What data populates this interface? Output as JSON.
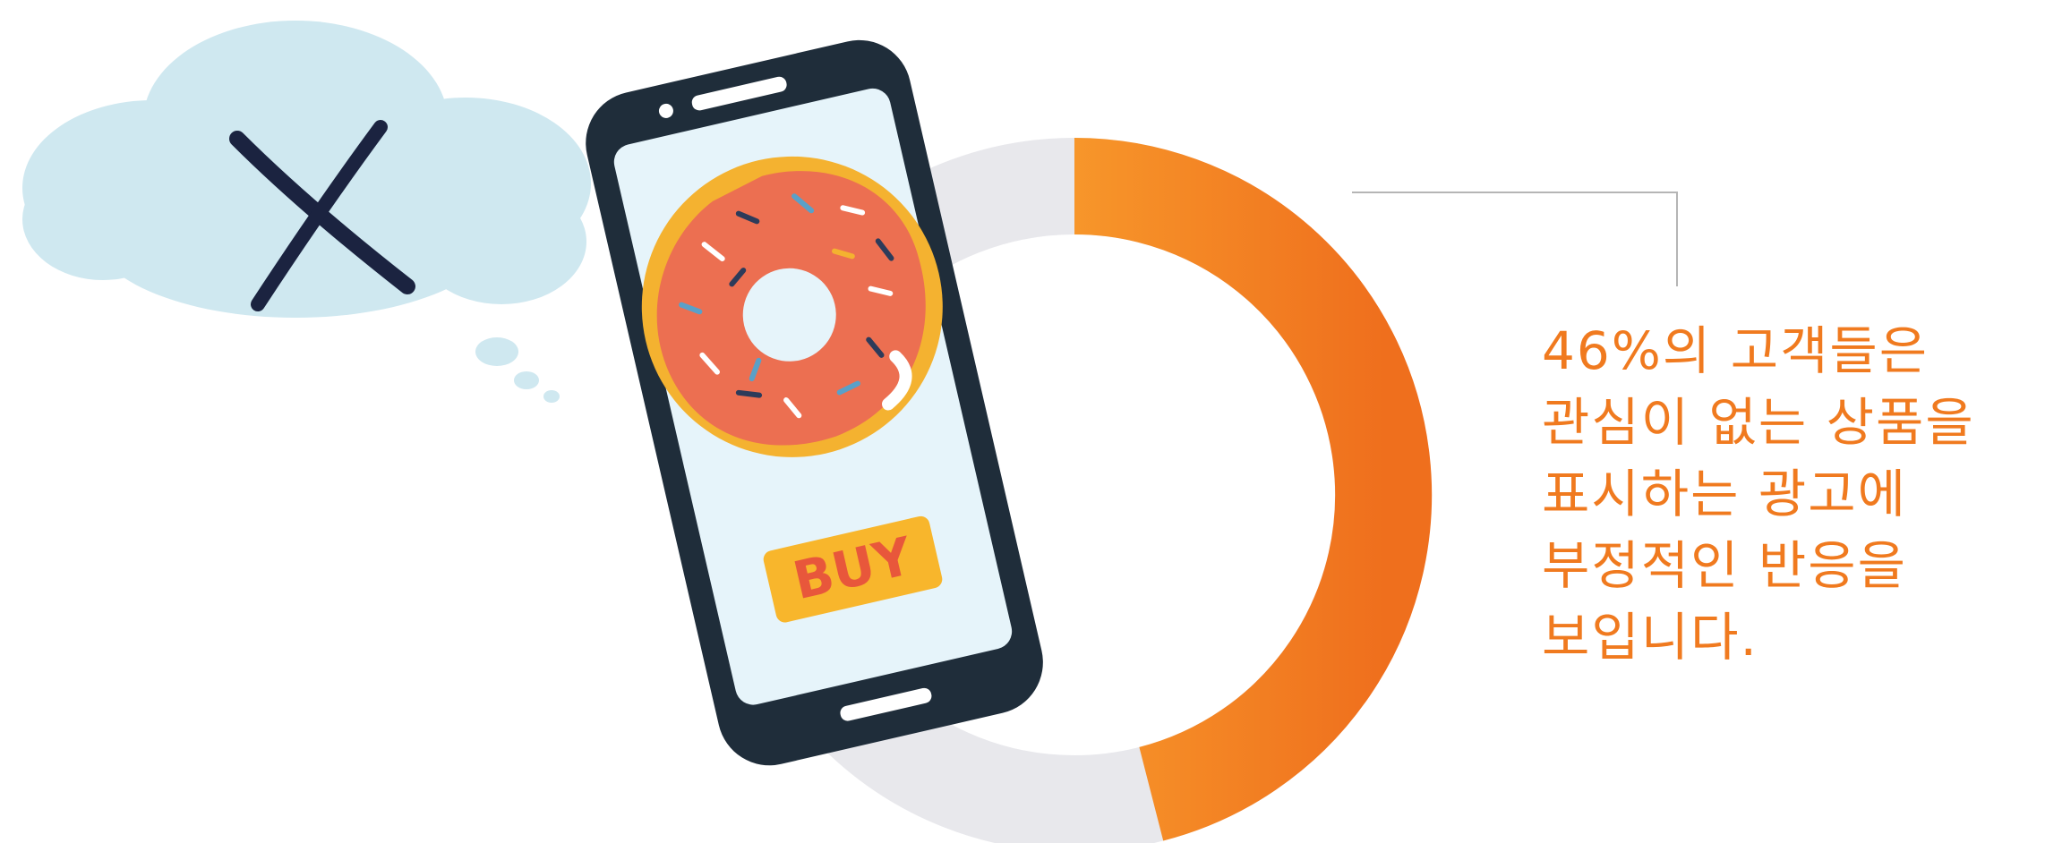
{
  "stat": {
    "percent": 46,
    "caption_lines": [
      "46%의 고객들은",
      "관심이 없는 상품을",
      "표시하는 광고에",
      "부정적인 반응을",
      "보입니다."
    ]
  },
  "phone": {
    "button_label": "BUY"
  },
  "colors": {
    "accent": "#f07a1f",
    "ring_track": "#e8e8ec",
    "cloud": "#cfe8f0",
    "phone_body": "#1f2d3a",
    "screen": "#e6f4fa",
    "donut_glaze": "#ec6f51",
    "donut_dough": "#f4b230",
    "buy_button": "#f8b62c",
    "buy_text": "#e8573b"
  },
  "icons": {
    "thought": "cloud-icon",
    "reject": "x-mark-icon"
  }
}
